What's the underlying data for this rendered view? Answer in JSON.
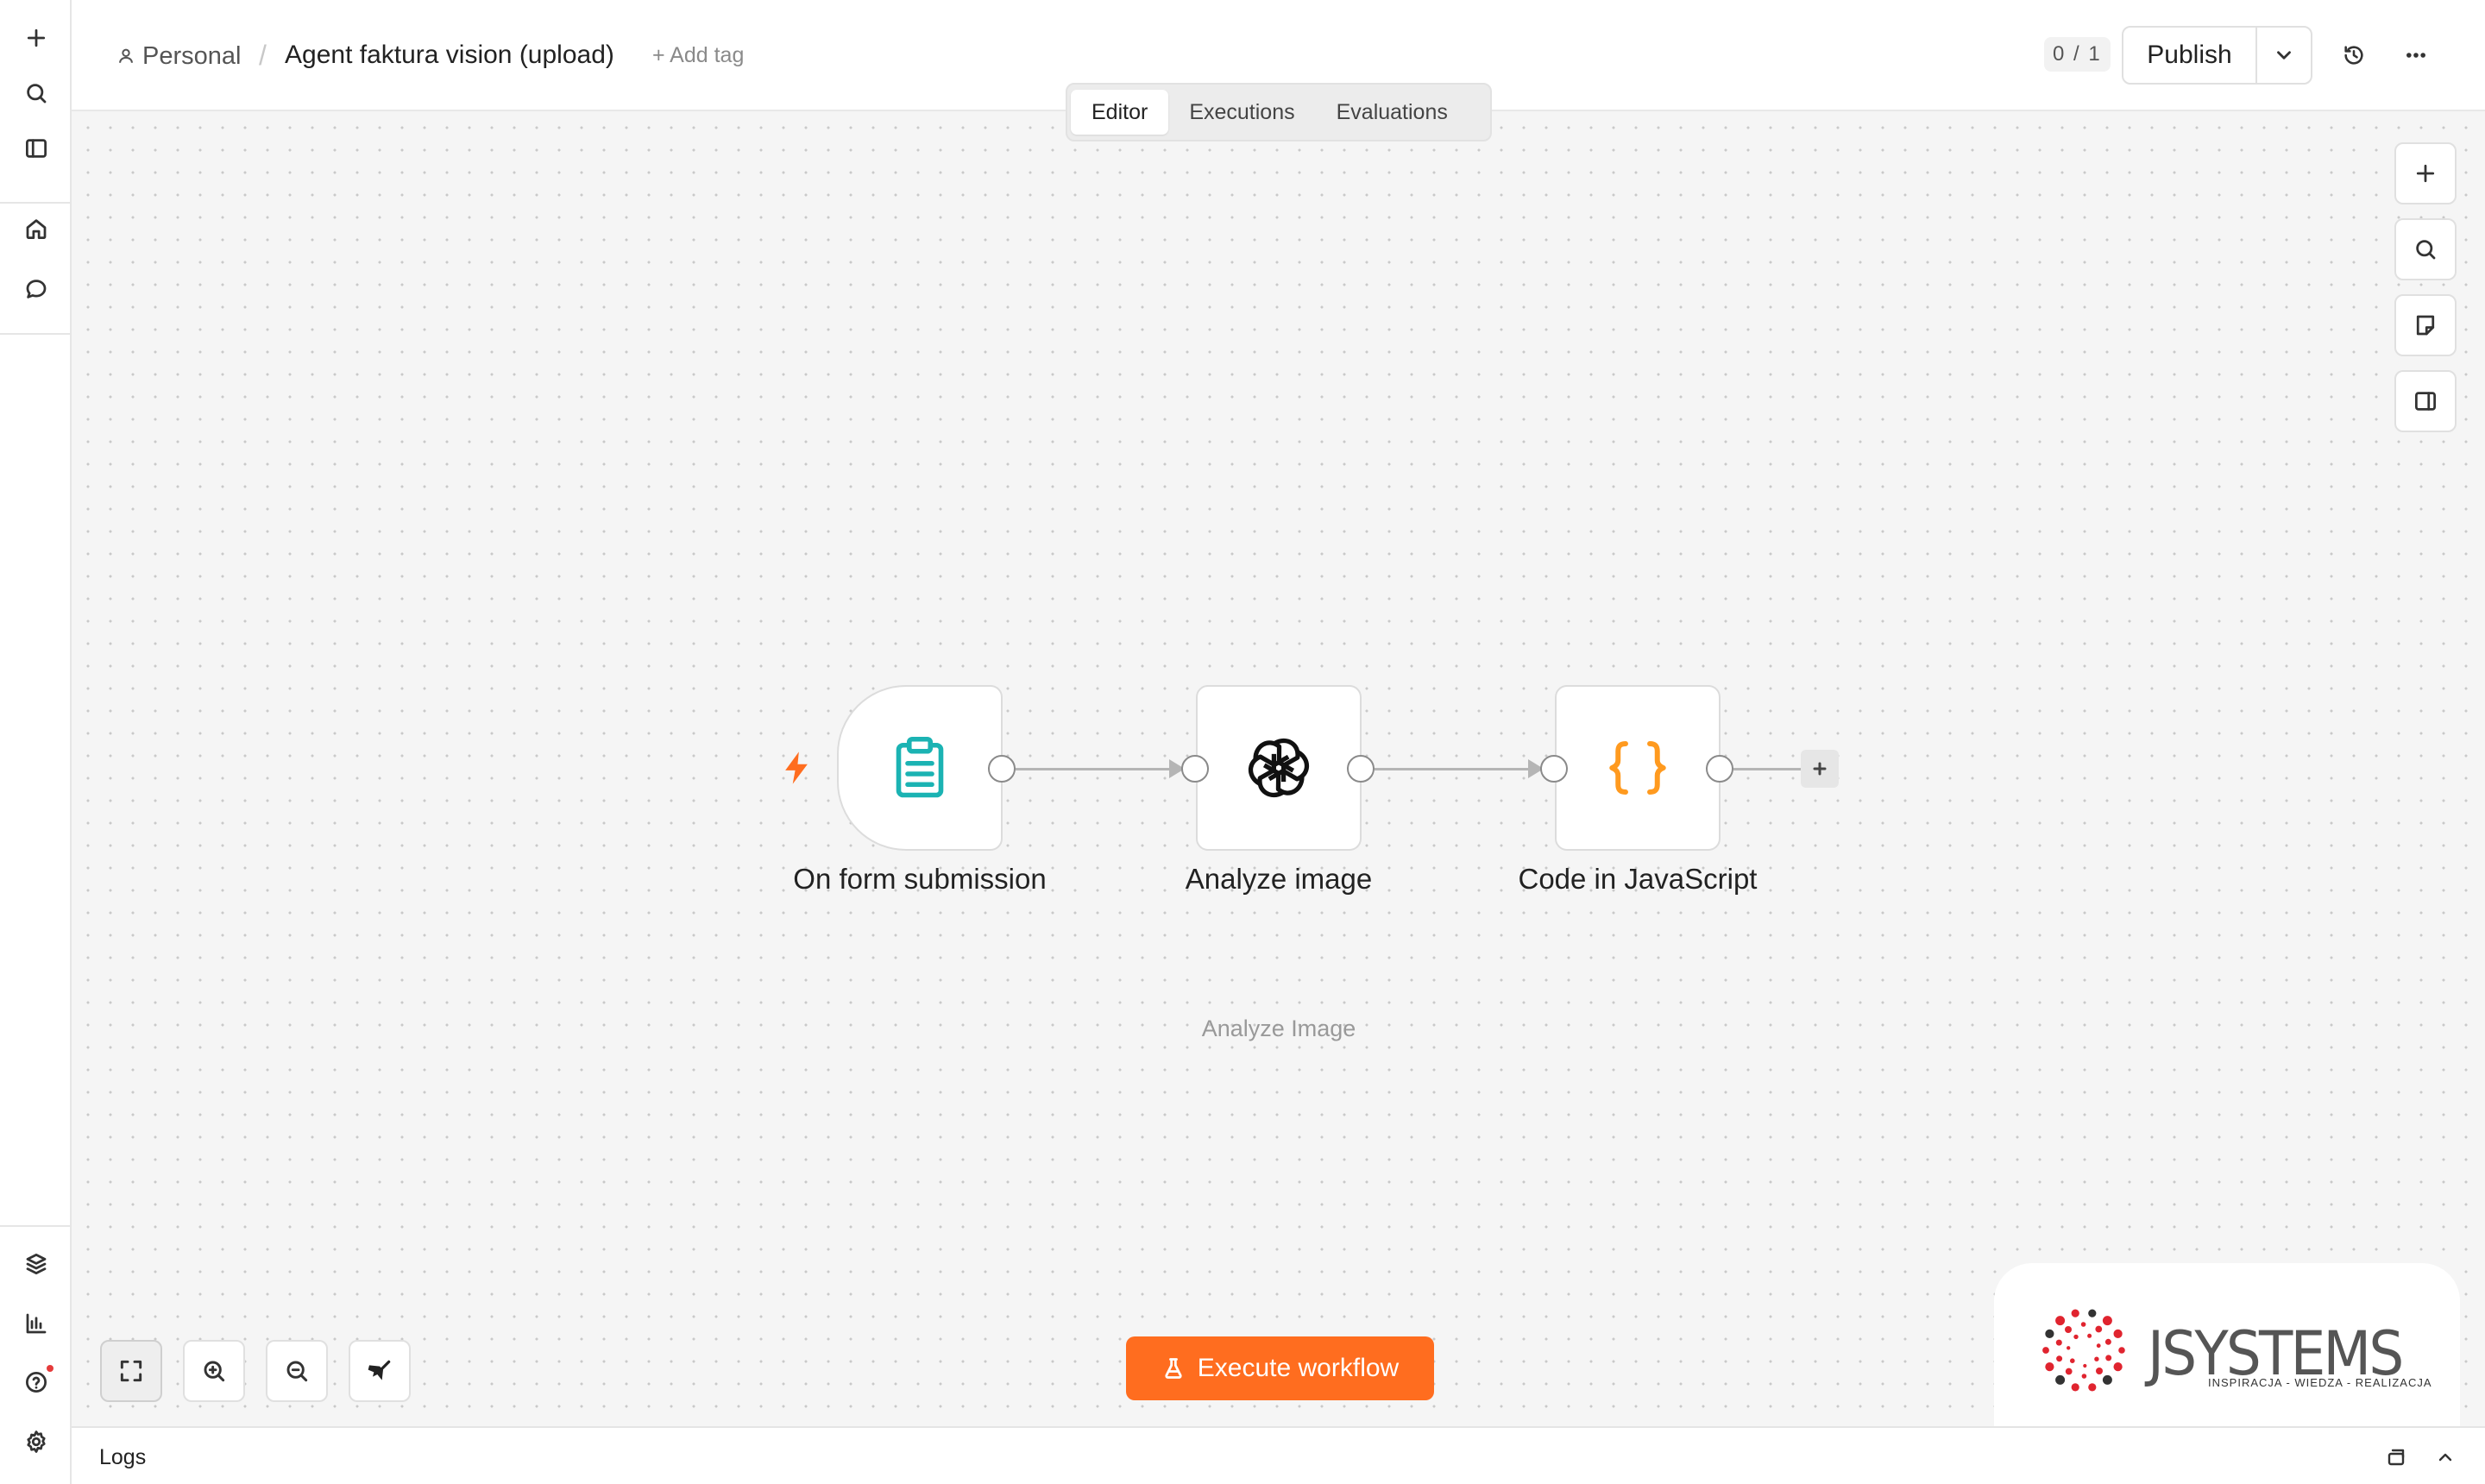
{
  "breadcrumb": {
    "project": "Personal",
    "separator": "/",
    "workflow_name": "Agent faktura vision (upload)",
    "add_tag": "+ Add tag"
  },
  "header": {
    "counter": "0 / 1",
    "publish_label": "Publish"
  },
  "tabs": [
    {
      "label": "Editor",
      "active": true
    },
    {
      "label": "Executions",
      "active": false
    },
    {
      "label": "Evaluations",
      "active": false
    }
  ],
  "nodes": [
    {
      "name": "On form submission",
      "subtitle": "",
      "icon": "clipboard-icon",
      "color": "#1bb3b3"
    },
    {
      "name": "Analyze image",
      "subtitle": "Analyze Image",
      "icon": "openai-icon",
      "color": "#111111"
    },
    {
      "name": "Code in JavaScript",
      "subtitle": "",
      "icon": "curly-braces-icon",
      "color": "#ff9a1f"
    }
  ],
  "execute_button": {
    "label": "Execute workflow"
  },
  "logo": {
    "text": "JSYSTEMS",
    "tagline": "INSPIRACJA - WIEDZA - REALIZACJA"
  },
  "logs": {
    "label": "Logs"
  },
  "colors": {
    "accent": "#ff6d1f",
    "trigger_bolt": "#ff6d1f",
    "canvas_bg": "#f5f5f5",
    "logo_red": "#e0242f"
  }
}
